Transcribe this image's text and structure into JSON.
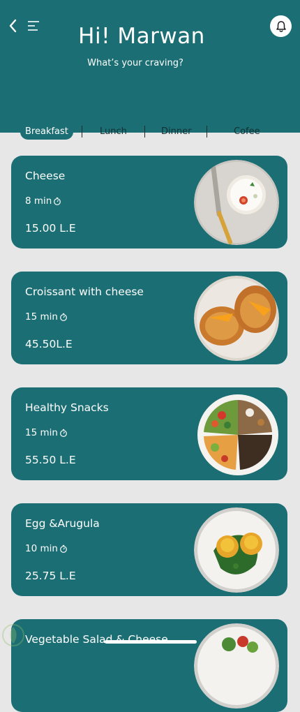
{
  "header": {
    "greeting": "Hi! Marwan",
    "subtitle": "What’s your craving?",
    "background_color": "#1b6f74",
    "icons": [
      "back-icon",
      "menu-icon",
      "bell-icon"
    ]
  },
  "tabs": [
    {
      "label": "Breakfast",
      "active": true
    },
    {
      "label": "Lunch",
      "active": false
    },
    {
      "label": "Dinner",
      "active": false
    },
    {
      "label": "Cofee",
      "active": false
    }
  ],
  "items": [
    {
      "name": "Cheese",
      "time": "8 min",
      "price": "15.00 L.E",
      "image": "cheese-plate"
    },
    {
      "name": "Croissant with cheese",
      "time": "15 min",
      "price": "45.50L.E",
      "image": "croissant-plate"
    },
    {
      "name": "Healthy Snacks",
      "time": "15 min",
      "price": "55.50 L.E",
      "image": "snacks-plate"
    },
    {
      "name": "Egg &Arugula",
      "time": "10 min",
      "price": "25.75 L.E",
      "image": "egg-plate"
    },
    {
      "name": "Vegetable Salad & Cheese",
      "image": "salad-plate"
    }
  ],
  "colors": {
    "accent": "#1b6f74",
    "background": "#e7e7e7"
  }
}
